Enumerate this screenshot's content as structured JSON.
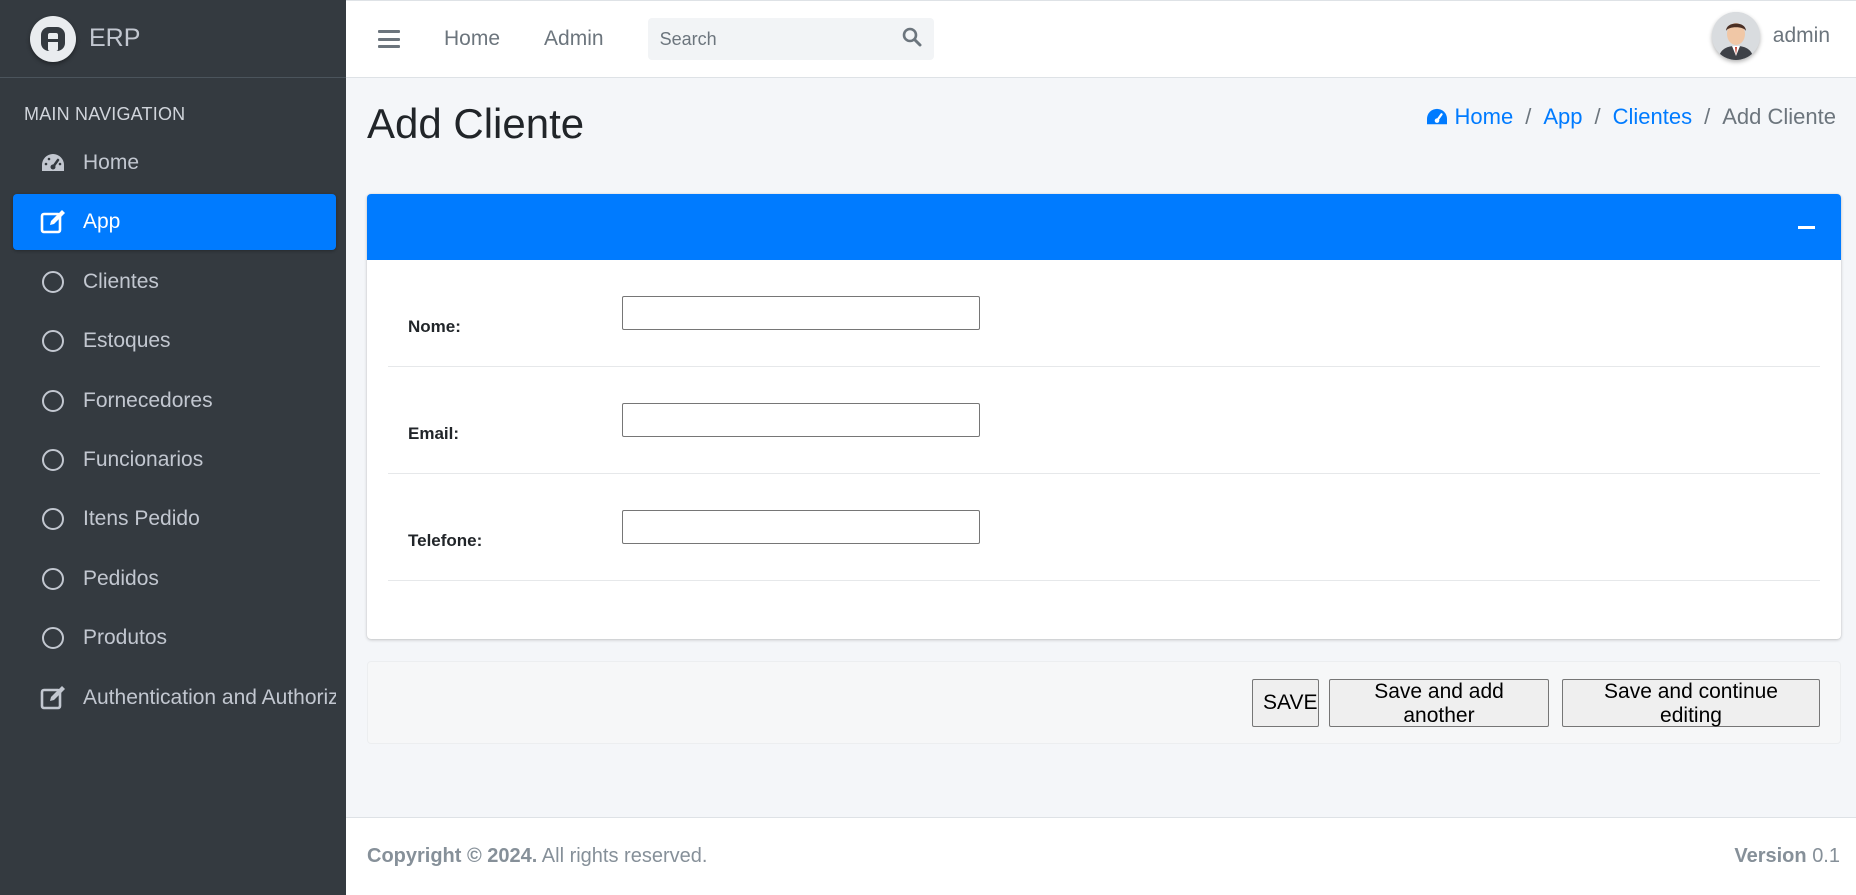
{
  "brand": {
    "name": "ERP"
  },
  "sidebar": {
    "header": "MAIN NAVIGATION",
    "items": [
      {
        "label": "Home",
        "icon": "tachometer-icon",
        "active": false
      },
      {
        "label": "App",
        "icon": "edit-icon",
        "active": true
      },
      {
        "label": "Clientes",
        "icon": "circle-icon",
        "active": false
      },
      {
        "label": "Estoques",
        "icon": "circle-icon",
        "active": false
      },
      {
        "label": "Fornecedores",
        "icon": "circle-icon",
        "active": false
      },
      {
        "label": "Funcionarios",
        "icon": "circle-icon",
        "active": false
      },
      {
        "label": "Itens Pedido",
        "icon": "circle-icon",
        "active": false
      },
      {
        "label": "Pedidos",
        "icon": "circle-icon",
        "active": false
      },
      {
        "label": "Produtos",
        "icon": "circle-icon",
        "active": false
      },
      {
        "label": "Authentication and Authoriz",
        "icon": "edit-icon",
        "active": false
      }
    ]
  },
  "topbar": {
    "links": [
      "Home",
      "Admin"
    ],
    "search_placeholder": "Search",
    "user_name": "admin"
  },
  "page": {
    "title": "Add Cliente",
    "breadcrumb": [
      "Home",
      "App",
      "Clientes",
      "Add Cliente"
    ]
  },
  "form": {
    "fields": [
      {
        "label": "Nome:",
        "value": ""
      },
      {
        "label": "Email:",
        "value": ""
      },
      {
        "label": "Telefone:",
        "value": ""
      }
    ]
  },
  "actions": {
    "save": "SAVE",
    "save_add_another": "Save and add another",
    "save_continue": "Save and continue editing"
  },
  "footer": {
    "copyright_bold": "Copyright © 2024.",
    "copyright_rest": "All rights reserved.",
    "version_label": "Version",
    "version_value": "0.1"
  },
  "colors": {
    "accent": "#007bff",
    "sidebar_bg": "#343a40",
    "content_bg": "#f4f6f9"
  }
}
